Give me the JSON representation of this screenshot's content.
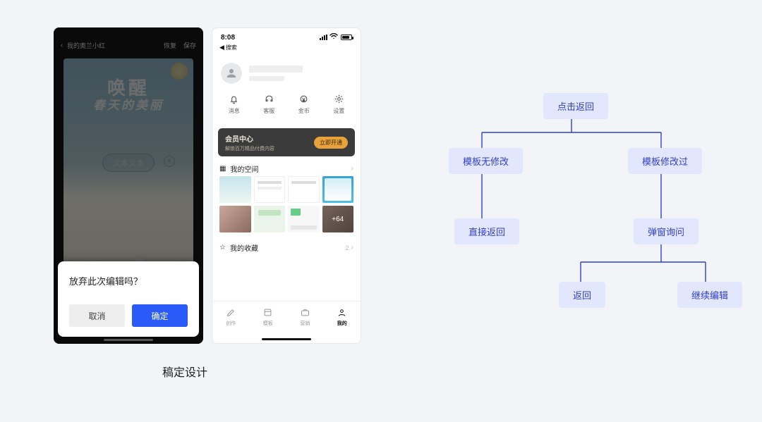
{
  "phone1": {
    "topbar": {
      "title": "我的奥兰小红",
      "action_redo": "恢复",
      "action_save": "保存"
    },
    "hero": {
      "line1": "唤醒",
      "line2": "春天的美丽",
      "chip": "文本文本",
      "plus": "+"
    },
    "modal": {
      "question": "放弃此次编辑吗？",
      "cancel": "取消",
      "confirm": "确定"
    }
  },
  "phone2": {
    "status": {
      "time": "8:08",
      "back": "搜索"
    },
    "actions": [
      {
        "label": "消息"
      },
      {
        "label": "客服"
      },
      {
        "label": "金币"
      },
      {
        "label": "设置"
      }
    ],
    "vip": {
      "title": "会员中心",
      "subtitle": "解锁百万精品付费内容",
      "cta": "立即开通"
    },
    "sections": {
      "space": {
        "title": "我的空间",
        "more_count": "+64"
      },
      "fav": {
        "title": "我的收藏",
        "count": "2"
      }
    },
    "tabs": [
      {
        "label": "创作"
      },
      {
        "label": "模板"
      },
      {
        "label": "营销"
      },
      {
        "label": "我的"
      }
    ]
  },
  "caption": "稿定设计",
  "flow": {
    "n1": "点击返回",
    "n2": "模板无修改",
    "n3": "模板修改过",
    "n4": "直接返回",
    "n5": "弹窗询问",
    "n6": "返回",
    "n7": "继续编辑"
  }
}
